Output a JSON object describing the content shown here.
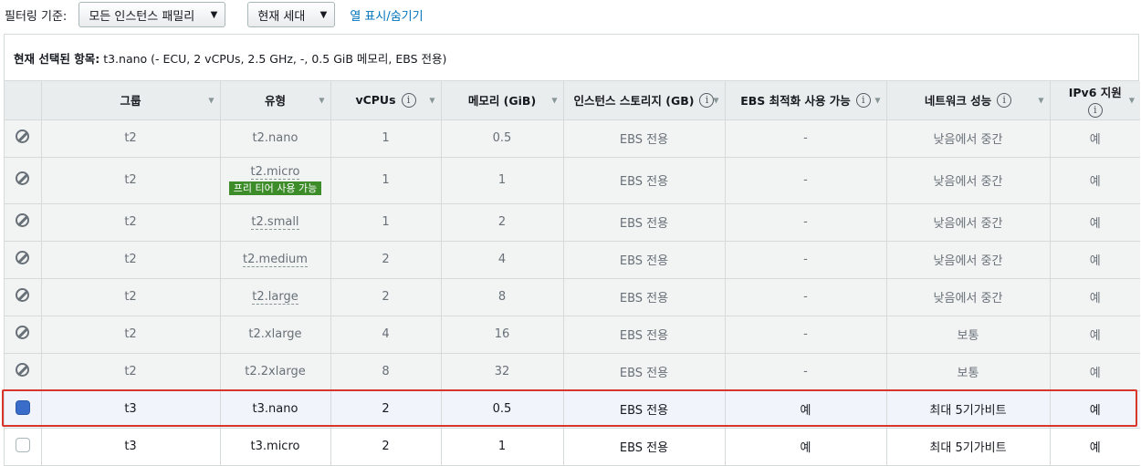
{
  "filter": {
    "label": "필터링 기준:",
    "family_value": "모든 인스턴스 패밀리",
    "generation_value": "현재 세대",
    "columns_link": "열 표시/숨기기"
  },
  "selected": {
    "label": "현재 선택된 항목:",
    "value": "t3.nano (- ECU, 2 vCPUs, 2.5 GHz, -, 0.5 GiB 메모리, EBS 전용)"
  },
  "columns": {
    "group": "그룹",
    "type": "유형",
    "vcpus": "vCPUs",
    "memory": "메모리 (GiB)",
    "storage": "인스턴스 스토리지 (GB)",
    "ebs": "EBS 최적화 사용 가능",
    "network": "네트워크 성능",
    "ipv6": "IPv6 지원",
    "info": "i"
  },
  "rows": [
    {
      "group": "t2",
      "type": "t2.nano",
      "vcpus": "1",
      "memory": "0.5",
      "storage": "EBS 전용",
      "ebs": "-",
      "network": "낮음에서 중간",
      "ipv6": "예"
    },
    {
      "group": "t2",
      "type": "t2.micro",
      "badge": "프리 티어 사용 가능",
      "vcpus": "1",
      "memory": "1",
      "storage": "EBS 전용",
      "ebs": "-",
      "network": "낮음에서 중간",
      "ipv6": "예"
    },
    {
      "group": "t2",
      "type": "t2.small",
      "vcpus": "1",
      "memory": "2",
      "storage": "EBS 전용",
      "ebs": "-",
      "network": "낮음에서 중간",
      "ipv6": "예"
    },
    {
      "group": "t2",
      "type": "t2.medium",
      "vcpus": "2",
      "memory": "4",
      "storage": "EBS 전용",
      "ebs": "-",
      "network": "낮음에서 중간",
      "ipv6": "예"
    },
    {
      "group": "t2",
      "type": "t2.large",
      "vcpus": "2",
      "memory": "8",
      "storage": "EBS 전용",
      "ebs": "-",
      "network": "낮음에서 중간",
      "ipv6": "예"
    },
    {
      "group": "t2",
      "type": "t2.xlarge",
      "vcpus": "4",
      "memory": "16",
      "storage": "EBS 전용",
      "ebs": "-",
      "network": "보통",
      "ipv6": "예"
    },
    {
      "group": "t2",
      "type": "t2.2xlarge",
      "vcpus": "8",
      "memory": "32",
      "storage": "EBS 전용",
      "ebs": "-",
      "network": "보통",
      "ipv6": "예"
    },
    {
      "group": "t3",
      "type": "t3.nano",
      "vcpus": "2",
      "memory": "0.5",
      "storage": "EBS 전용",
      "ebs": "예",
      "network": "최대 5기가비트",
      "ipv6": "예"
    },
    {
      "group": "t3",
      "type": "t3.micro",
      "vcpus": "2",
      "memory": "1",
      "storage": "EBS 전용",
      "ebs": "예",
      "network": "최대 5기가비트",
      "ipv6": "예"
    }
  ]
}
